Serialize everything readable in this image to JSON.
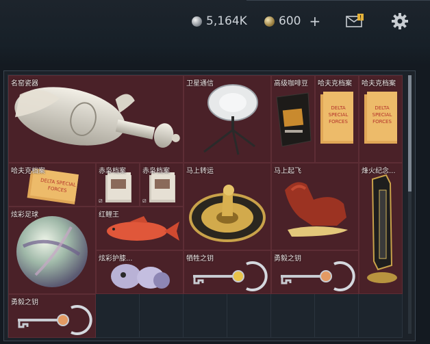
{
  "header": {
    "currency_silver": "5,164K",
    "currency_gold": "600",
    "plus_label": "+",
    "mail_badge": "!"
  },
  "colors": {
    "item_bg": "#4a2128",
    "empty_cell": "#1d252d",
    "panel_border": "#3b4651"
  },
  "items": [
    {
      "name": "名窑瓷器",
      "icon": "porcelain-vase-icon"
    },
    {
      "name": "卫星通信",
      "icon": "satellite-dish-icon"
    },
    {
      "name": "高级咖啡豆",
      "icon": "coffee-bag-icon"
    },
    {
      "name": "哈夫克档案",
      "icon": "folder-icon"
    },
    {
      "name": "哈夫克档案",
      "icon": "folder-icon"
    },
    {
      "name": "哈夫克档案",
      "icon": "folder-icon"
    },
    {
      "name": "赤枭档案",
      "icon": "file-stack-icon"
    },
    {
      "name": "赤枭档案",
      "icon": "file-stack-icon"
    },
    {
      "name": "马上转运",
      "icon": "golden-wheel-icon"
    },
    {
      "name": "马上起飞",
      "icon": "red-horse-icon"
    },
    {
      "name": "烽火纪念...",
      "icon": "golden-pillar-icon"
    },
    {
      "name": "炫彩足球",
      "icon": "iridescent-ball-icon"
    },
    {
      "name": "红鲤王",
      "icon": "red-carp-icon"
    },
    {
      "name": "炫彩护膝...",
      "icon": "cartoon-figure-icon"
    },
    {
      "name": "牺牲之钥",
      "icon": "key-icon"
    },
    {
      "name": "勇毅之钥",
      "icon": "key-icon"
    },
    {
      "name": "勇毅之钥",
      "icon": "key-icon"
    }
  ]
}
